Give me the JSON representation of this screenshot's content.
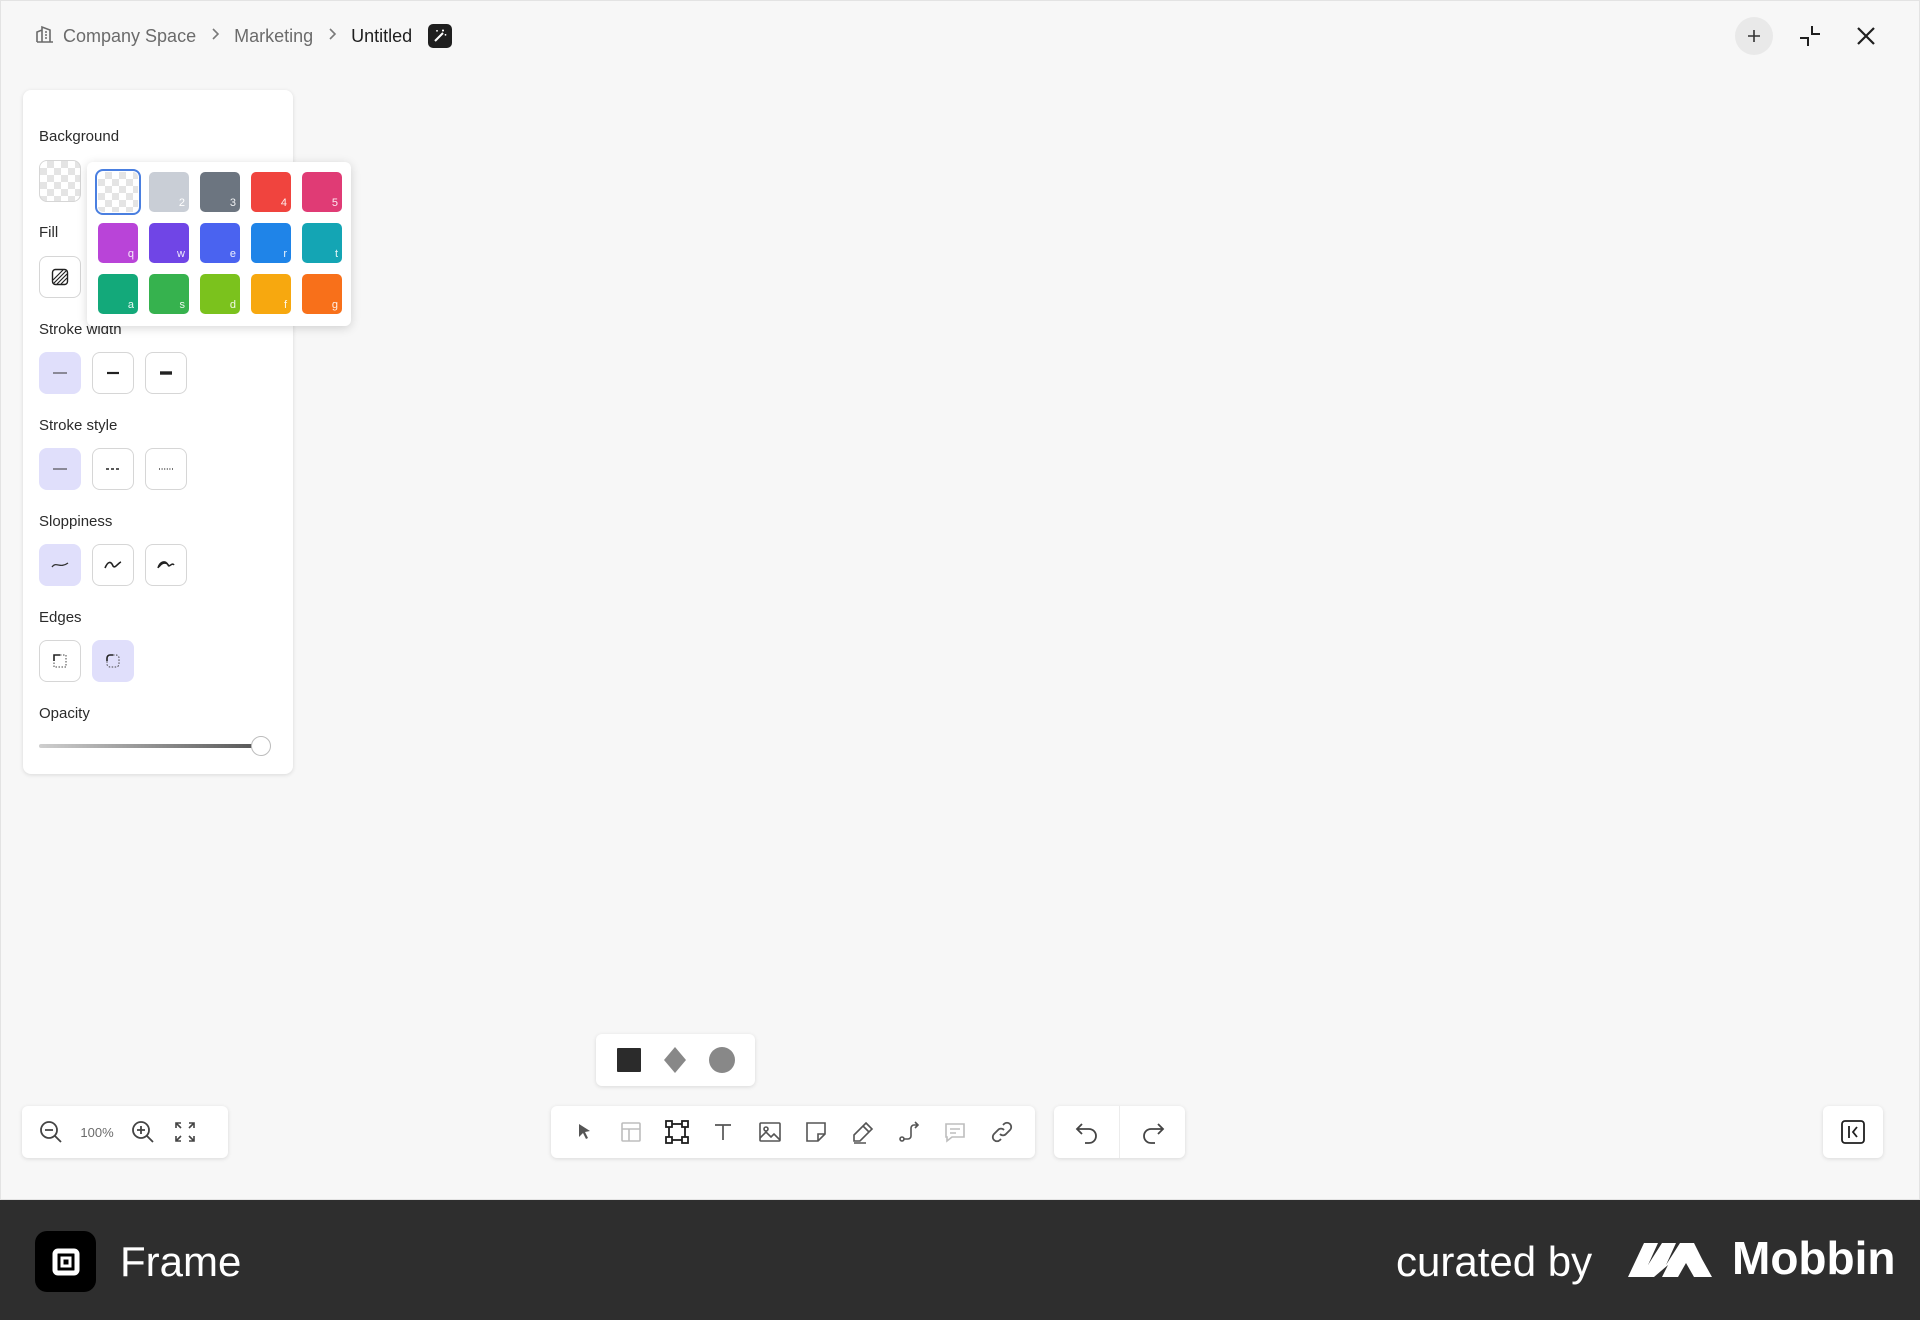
{
  "breadcrumb": {
    "items": [
      {
        "label": "Company Space"
      },
      {
        "label": "Marketing"
      },
      {
        "label": "Untitled"
      }
    ]
  },
  "panel": {
    "background_label": "Background",
    "fill_label": "Fill",
    "stroke_width_label": "Stroke width",
    "stroke_style_label": "Stroke style",
    "sloppiness_label": "Sloppiness",
    "edges_label": "Edges",
    "opacity_label": "Opacity",
    "opacity_value": 100
  },
  "palette": {
    "colors": [
      {
        "key": "",
        "color": "transparent",
        "selected": true
      },
      {
        "key": "2",
        "color": "#c9ced6"
      },
      {
        "key": "3",
        "color": "#6c7580"
      },
      {
        "key": "4",
        "color": "#f0443e"
      },
      {
        "key": "5",
        "color": "#e03b75"
      },
      {
        "key": "q",
        "color": "#b944d8"
      },
      {
        "key": "w",
        "color": "#7045e6"
      },
      {
        "key": "e",
        "color": "#4a63f0"
      },
      {
        "key": "r",
        "color": "#1f84e8"
      },
      {
        "key": "t",
        "color": "#14a5b4"
      },
      {
        "key": "a",
        "color": "#13a97a"
      },
      {
        "key": "s",
        "color": "#36b24e"
      },
      {
        "key": "d",
        "color": "#7bc21d"
      },
      {
        "key": "f",
        "color": "#f7a80f"
      },
      {
        "key": "g",
        "color": "#f8701a"
      }
    ]
  },
  "zoom": {
    "level": "100%"
  },
  "footer": {
    "app_name": "Frame",
    "curated_by": "curated by",
    "brand": "Mobbin"
  }
}
